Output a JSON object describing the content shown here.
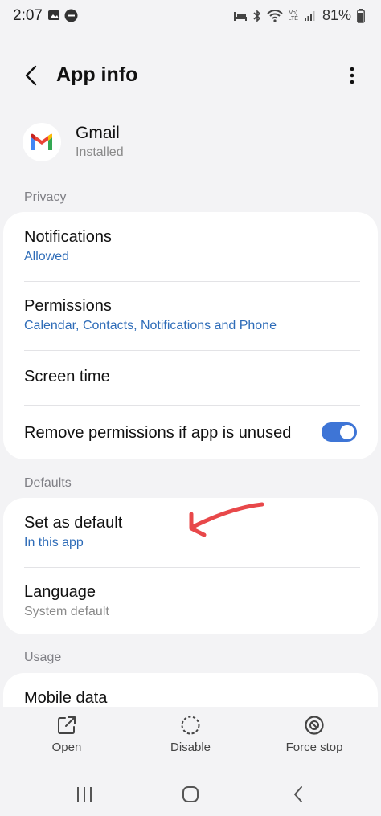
{
  "status_bar": {
    "time": "2:07",
    "battery": "81%",
    "volte_line1": "Vo)",
    "volte_line2": "LTE"
  },
  "app_bar": {
    "title": "App info"
  },
  "app": {
    "name": "Gmail",
    "status": "Installed"
  },
  "sections": {
    "privacy_label": "Privacy",
    "defaults_label": "Defaults",
    "usage_label": "Usage"
  },
  "privacy": {
    "notifications_title": "Notifications",
    "notifications_sub": "Allowed",
    "permissions_title": "Permissions",
    "permissions_sub": "Calendar, Contacts, Notifications and Phone",
    "screen_time_title": "Screen time",
    "remove_perms_title": "Remove permissions if app is unused",
    "remove_perms_on": true
  },
  "defaults": {
    "set_default_title": "Set as default",
    "set_default_sub": "In this app",
    "language_title": "Language",
    "language_sub": "System default"
  },
  "usage": {
    "mobile_data_title": "Mobile data"
  },
  "actions": {
    "open": "Open",
    "disable": "Disable",
    "force_stop": "Force stop"
  },
  "colors": {
    "accent": "#3e75d6",
    "link": "#2e6cb8",
    "annotation": "#e8484a"
  }
}
